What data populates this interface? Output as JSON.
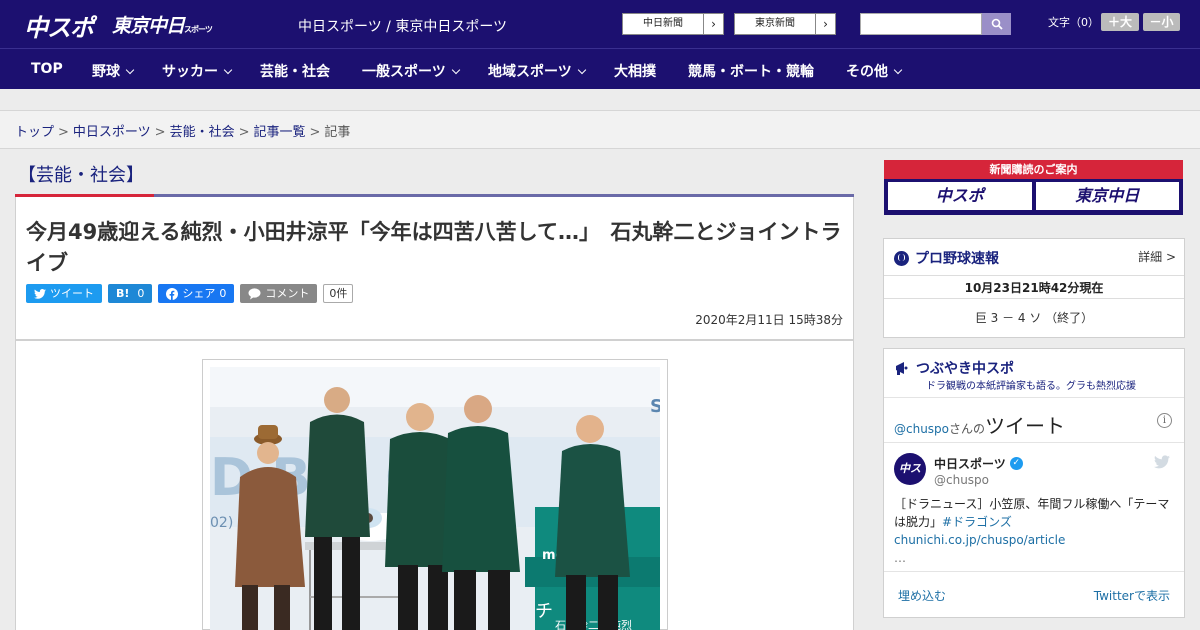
{
  "header": {
    "logo_main": "中スポ",
    "logo_sub": "東京中日",
    "logo_sub_small": "スポーツ",
    "site_names": "中日スポーツ / 東京中日スポーツ",
    "paper_buttons": [
      "中日新聞",
      "東京新聞"
    ],
    "search_placeholder": "",
    "font_size_label": "文字（0）",
    "font_larger": "＋大",
    "font_smaller": "－小"
  },
  "nav": {
    "items": [
      {
        "label": "TOP",
        "dropdown": false
      },
      {
        "label": "野球",
        "dropdown": true
      },
      {
        "label": "サッカー",
        "dropdown": true
      },
      {
        "label": "芸能・社会",
        "dropdown": false
      },
      {
        "label": "一般スポーツ",
        "dropdown": true
      },
      {
        "label": "地域スポーツ",
        "dropdown": true
      },
      {
        "label": "大相撲",
        "dropdown": false
      },
      {
        "label": "競馬・ボート・競輪",
        "dropdown": false
      },
      {
        "label": "その他",
        "dropdown": true
      }
    ]
  },
  "breadcrumb": {
    "items": [
      "トップ",
      "中日スポーツ",
      "芸能・社会",
      "記事一覧"
    ],
    "current": "記事"
  },
  "article": {
    "category": "【芸能・社会】",
    "headline": "今月49歳迎える純烈・小田井涼平「今年は四苦八苦して…」　石丸幹二とジョイントライブ",
    "share": {
      "tweet": "ツイート",
      "hatena_label": "B!",
      "hatena_count": "0",
      "facebook": "シェア",
      "facebook_count": "0",
      "comment": "コメント",
      "comment_count": "0件"
    },
    "date": "2020年2月11日 15時38分"
  },
  "sidebar": {
    "subscribe_head": "新聞購読のご案内",
    "subscribe_logos": [
      "中スポ",
      "東京中日"
    ],
    "baseball": {
      "title": "プロ野球速報",
      "detail": "詳細 >",
      "time": "10月23日21時42分現在",
      "score": "巨 3 － 4 ソ （終了）"
    },
    "tweets": {
      "title": "つぶやき中スポ",
      "subtitle": "ドラ観戦の本紙評論家も語る。グラも熱烈応援",
      "handle_prefix": "@chuspo",
      "handle_suffix": "さんの",
      "handle_big": "ツイート",
      "avatar": "中スポ",
      "name": "中日スポーツ",
      "user": "@chuspo",
      "text": "［ドラニュース］小笠原、年間フル稼働へ「テーマは脱力」",
      "hashtag": "#ドラゴンズ",
      "link": "chunichi.co.jp/chuspo/article",
      "ellipsis": "…",
      "embed": "埋め込む",
      "view": "Twitterで表示"
    }
  },
  "colors": {
    "brand": "#1c1070",
    "accent_red": "#d6253a",
    "link": "#1a237e"
  }
}
